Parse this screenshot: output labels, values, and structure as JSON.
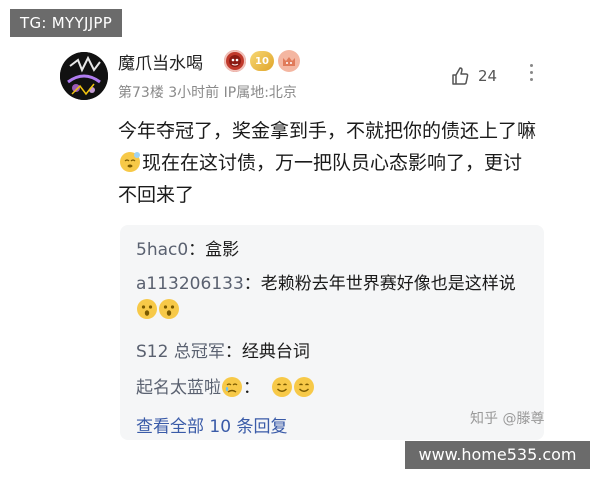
{
  "watermark_top": "TG: MYYJJPP",
  "comment": {
    "username": "魔爪当水喝",
    "badge_level": "10",
    "meta": "第73楼  3小时前  IP属地:北京",
    "likes": "24",
    "text_part1": "今年夺冠了，奖金拿到手，不就把你的债还上了嘛",
    "text_part2": "现在在这讨债，万一把队员心态影响了，更讨不回来了",
    "icons": {
      "like": "thumbs-up-icon",
      "more": "more-vertical-icon"
    }
  },
  "replies": [
    {
      "name": "5hac0",
      "sep": "：",
      "text": "盒影"
    },
    {
      "name": "a113206133",
      "sep": "：",
      "text": "老赖粉去年世界赛好像也是这样说"
    },
    {
      "name": "S12 总冠军",
      "sep": "：",
      "text": "经典台词"
    },
    {
      "name": "起名太蓝啦",
      "sep": "",
      "text": "："
    }
  ],
  "view_all": "查看全部 10 条回复",
  "watermark_zhihu": "知乎 @滕尊",
  "watermark_site": "www.home535.com"
}
